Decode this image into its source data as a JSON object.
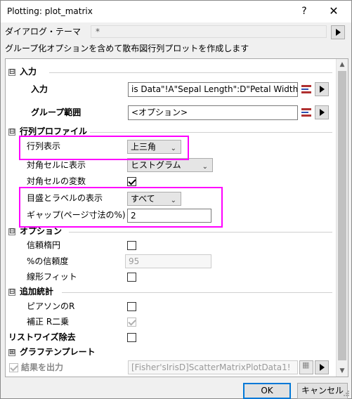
{
  "window": {
    "title": "Plotting: plot_matrix",
    "help": "?",
    "close": "✕"
  },
  "theme": {
    "label": "ダイアログ・テーマ",
    "value": "*"
  },
  "description": "グループ化オプションを含めて散布図行列プロットを作成します",
  "sections": {
    "input": {
      "expander": "⊟",
      "label": "入力",
      "input_label": "入力",
      "input_value": "is Data\"!A\"Sepal Length\":D\"Petal Width\"",
      "group_label": "グループ範囲",
      "group_value": "<オプション>"
    },
    "profile": {
      "expander": "⊟",
      "label": "行列プロファイル",
      "matrix_label": "行列表示",
      "matrix_value": "上三角",
      "diag_label": "対角セルに表示",
      "diag_value": "ヒストグラム",
      "diag_var_label": "対角セルの変数",
      "diag_var_checked": true,
      "tick_label": "目盛とラベルの表示",
      "tick_value": "すべて",
      "gap_label": "ギャップ(ページ寸法の%)",
      "gap_value": "2"
    },
    "options": {
      "expander": "⊟",
      "label": "オプション",
      "ellipse_label": "信頼楕円",
      "ellipse_checked": false,
      "conf_label": "%の信頼度",
      "conf_value": "95",
      "linear_label": "線形フィット",
      "linear_checked": false
    },
    "stats": {
      "expander": "⊟",
      "label": "追加統計",
      "pearson_label": "ピアソンのR",
      "pearson_checked": false,
      "adj_label": "補正 R二乗",
      "adj_checked": true
    },
    "listwise": {
      "label": "リストワイズ除去",
      "checked": false
    },
    "template": {
      "expander": "⊞",
      "label": "グラフテンプレート"
    },
    "output": {
      "label": "結果を出力",
      "checked": true,
      "value": "[Fisher'sIrisD]ScatterMatrixPlotData1!"
    }
  },
  "buttons": {
    "ok": "OK",
    "cancel": "キャンセル"
  },
  "highlight_color": "#ff00ff",
  "accent_color": "#0078d7"
}
